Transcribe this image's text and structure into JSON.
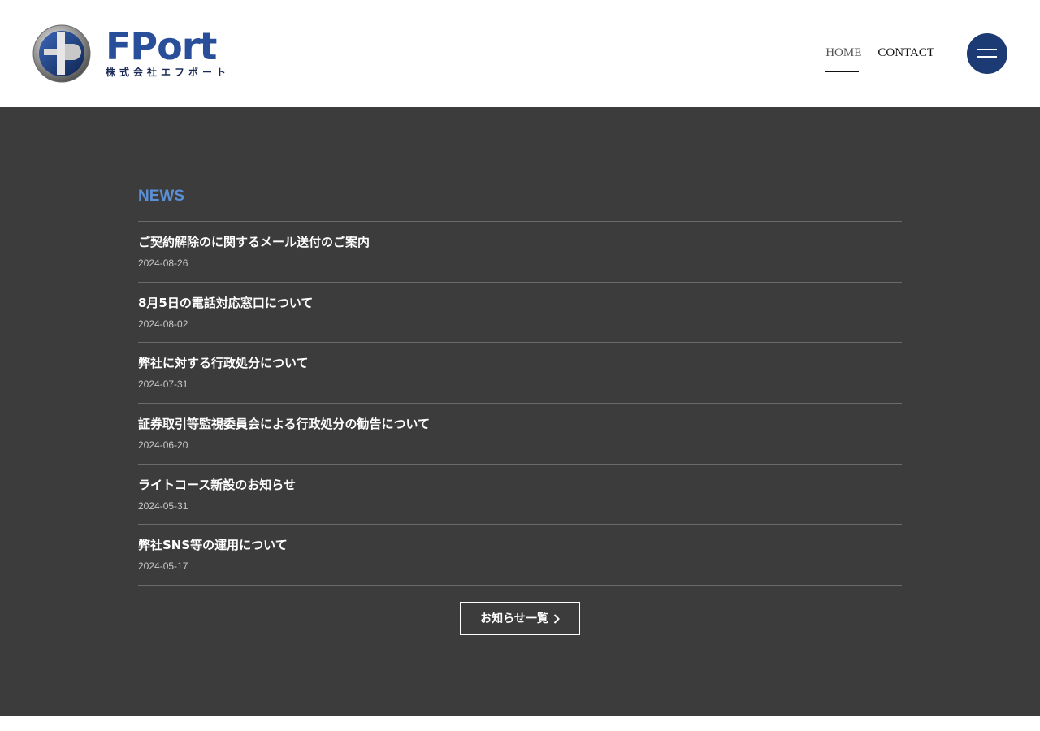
{
  "header": {
    "logo": {
      "wordmark": "FPort",
      "company_name": "株式会社エフポート",
      "icon": "fport-emblem-icon"
    },
    "nav": [
      {
        "label": "HOME",
        "active": true
      },
      {
        "label": "CONTACT",
        "active": false
      }
    ],
    "menu_icon": "hamburger-menu-icon"
  },
  "news": {
    "heading": "NEWS",
    "items": [
      {
        "title": "ご契約解除のに関するメール送付のご案内",
        "date": "2024-08-26"
      },
      {
        "title": "8月5日の電話対応窓口について",
        "date": "2024-08-02"
      },
      {
        "title": "弊社に対する行政処分について",
        "date": "2024-07-31"
      },
      {
        "title": "証券取引等監視委員会による行政処分の勧告について",
        "date": "2024-06-20"
      },
      {
        "title": "ライトコース新設のお知らせ",
        "date": "2024-05-31"
      },
      {
        "title": "弊社SNS等の運用について",
        "date": "2024-05-17"
      }
    ],
    "more_label": "お知らせ一覧",
    "more_icon": "chevron-right-icon"
  },
  "colors": {
    "brand_blue": "#1c3a73",
    "accent_blue": "#5b8fd6",
    "section_bg": "#3c3c3c"
  }
}
